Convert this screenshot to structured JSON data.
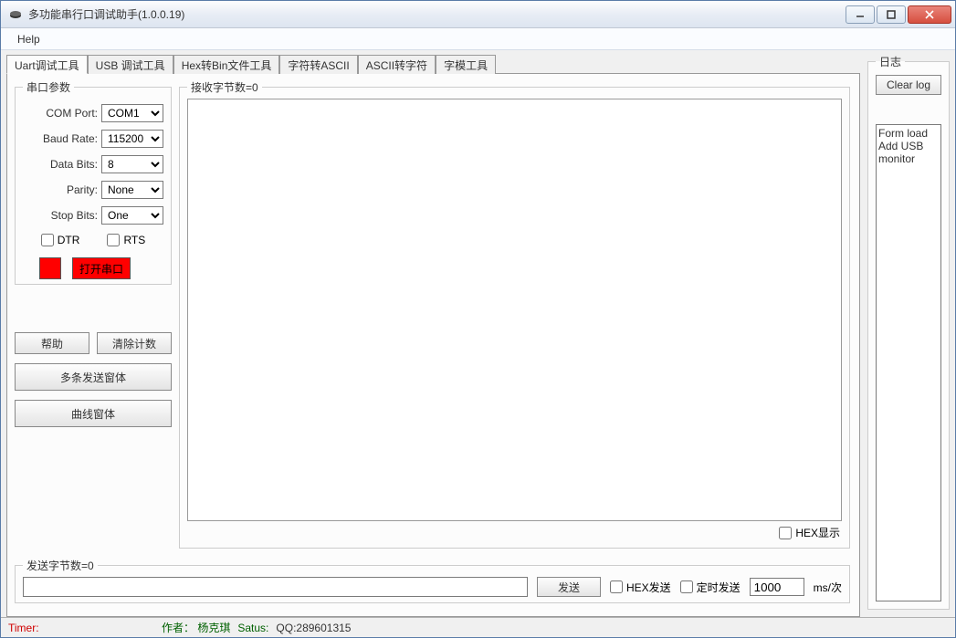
{
  "window": {
    "title": "多功能串行口调试助手(1.0.0.19)"
  },
  "menu": {
    "help": "Help"
  },
  "tabs": {
    "items": [
      {
        "label": "Uart调试工具"
      },
      {
        "label": "USB 调试工具"
      },
      {
        "label": "Hex转Bin文件工具"
      },
      {
        "label": "字符转ASCII"
      },
      {
        "label": "ASCII转字符"
      },
      {
        "label": "字模工具"
      }
    ]
  },
  "serial": {
    "legend": "串口参数",
    "com_port_label": "COM Port:",
    "com_port_value": "COM1",
    "baud_label": "Baud Rate:",
    "baud_value": "115200",
    "databits_label": "Data Bits:",
    "databits_value": "8",
    "parity_label": "Parity:",
    "parity_value": "None",
    "stopbits_label": "Stop Bits:",
    "stopbits_value": "One",
    "dtr_label": "DTR",
    "rts_label": "RTS",
    "open_label": "打开串口"
  },
  "left_buttons": {
    "help": "帮助",
    "clear_count": "清除计数",
    "multi_send": "多条发送窗体",
    "curve": "曲线窗体"
  },
  "recv": {
    "legend": "接收字节数=0",
    "hex_display": "HEX显示"
  },
  "send": {
    "legend": "发送字节数=0",
    "send_btn": "发送",
    "hex_send": "HEX发送",
    "timed_send": "定时发送",
    "interval": "1000",
    "interval_unit": "ms/次"
  },
  "log": {
    "legend": "日志",
    "clear_btn": "Clear log",
    "content": "Form load\nAdd USB monitor"
  },
  "status": {
    "timer": "Timer:",
    "author_label": "作者：",
    "author_name": "杨克琪",
    "satus_label": "Satus:",
    "qq": "QQ:289601315"
  }
}
